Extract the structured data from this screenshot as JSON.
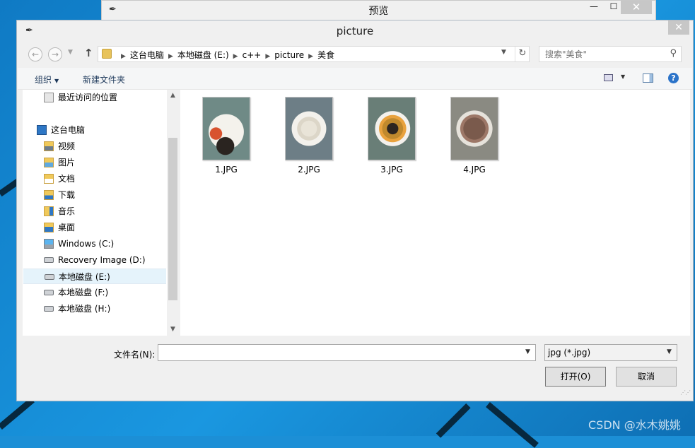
{
  "background_window": {
    "title": "预览",
    "min": "—",
    "max": "☐",
    "close": "✕"
  },
  "dialog": {
    "title": "picture",
    "close": "✕"
  },
  "nav": {
    "back": "←",
    "forward": "→",
    "up": "↑",
    "breadcrumbs": [
      "这台电脑",
      "本地磁盘 (E:)",
      "c++",
      "picture",
      "美食"
    ],
    "refresh": "↻",
    "search_placeholder": "搜索\"美食\""
  },
  "toolbar": {
    "organize": "组织",
    "new_folder": "新建文件夹"
  },
  "sidebar": {
    "items": [
      {
        "label": "最近访问的位置",
        "icon": "recent-places-icon"
      },
      {
        "label": "这台电脑",
        "icon": "computer-icon"
      },
      {
        "label": "视频",
        "icon": "videos-folder-icon"
      },
      {
        "label": "图片",
        "icon": "pictures-folder-icon"
      },
      {
        "label": "文档",
        "icon": "documents-folder-icon"
      },
      {
        "label": "下载",
        "icon": "downloads-folder-icon"
      },
      {
        "label": "音乐",
        "icon": "music-folder-icon"
      },
      {
        "label": "桌面",
        "icon": "desktop-folder-icon"
      },
      {
        "label": "Windows (C:)",
        "icon": "windows-drive-icon"
      },
      {
        "label": "Recovery Image (D:)",
        "icon": "drive-icon"
      },
      {
        "label": "本地磁盘 (E:)",
        "icon": "drive-icon",
        "selected": true
      },
      {
        "label": "本地磁盘 (F:)",
        "icon": "drive-icon"
      },
      {
        "label": "本地磁盘 (H:)",
        "icon": "drive-icon"
      }
    ]
  },
  "files": [
    {
      "name": "1.JPG"
    },
    {
      "name": "2.JPG"
    },
    {
      "name": "3.JPG"
    },
    {
      "name": "4.JPG"
    }
  ],
  "bottom": {
    "filename_label": "文件名(N):",
    "filename_value": "",
    "filetype": "jpg (*.jpg)",
    "open_button": "打开(O)",
    "cancel_button": "取消"
  },
  "watermark": "CSDN @水木姚姚",
  "colors": {
    "selection": "#e5f3fb",
    "link_text": "#1e395b",
    "desktop": "#1a97e0"
  }
}
